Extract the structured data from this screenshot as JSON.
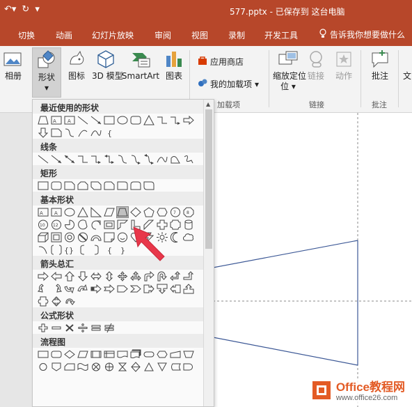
{
  "titlebar": {
    "doc_title": "577.pptx - 已保存到 这台电脑",
    "bg": "#b7472a"
  },
  "tabs": [
    "切换",
    "动画",
    "幻灯片放映",
    "审阅",
    "视图",
    "录制",
    "开发工具"
  ],
  "tell_me": "告诉我你想要做什么",
  "ribbon": {
    "album": "相册",
    "shapes": "形状",
    "icons": "图标",
    "model3d": "3D 模型",
    "smartart": "SmartArt",
    "chart": "图表",
    "app_store": "应用商店",
    "my_addins": "我的加载项",
    "addins_group": "加载项",
    "zoom": "缩放定位",
    "link": "链接",
    "action": "动作",
    "link_group": "链接",
    "comment": "批注",
    "comment_group": "批注",
    "text_partial": "文"
  },
  "gallery": {
    "recent": "最近使用的形状",
    "lines": "线条",
    "rectangles": "矩形",
    "basic": "基本形状",
    "arrows": "箭头总汇",
    "equation": "公式形状",
    "flowchart": "流程图"
  },
  "watermark": {
    "brand": "Office教程网",
    "url": "www.office26.com"
  },
  "colors": {
    "accent": "#b7472a",
    "arrow": "#e8374a",
    "line": "#3b5795",
    "selected": "#c0c0c0"
  }
}
